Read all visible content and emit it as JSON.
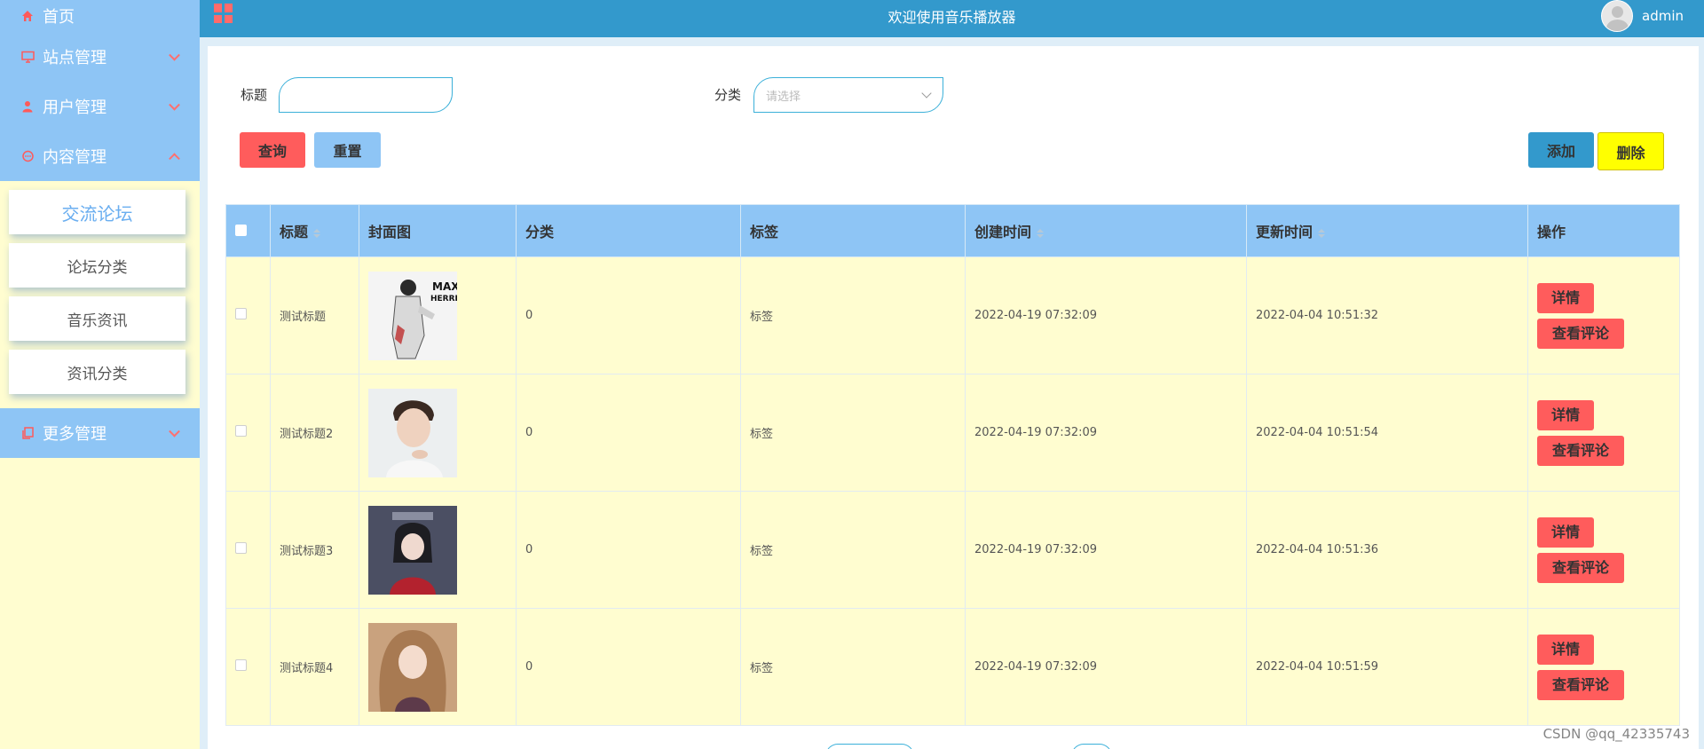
{
  "header": {
    "title": "欢迎使用音乐播放器",
    "username": "admin"
  },
  "sidebar": {
    "items": [
      {
        "label": "首页",
        "icon": "home-icon"
      },
      {
        "label": "站点管理",
        "icon": "monitor-icon"
      },
      {
        "label": "用户管理",
        "icon": "user-icon"
      },
      {
        "label": "内容管理",
        "icon": "chat-icon"
      },
      {
        "label": "更多管理",
        "icon": "copy-icon"
      }
    ],
    "submenu": [
      "交流论坛",
      "论坛分类",
      "音乐资讯",
      "资讯分类"
    ]
  },
  "search": {
    "title_label": "标题",
    "title_value": "",
    "category_label": "分类",
    "category_placeholder": "请选择"
  },
  "buttons": {
    "query": "查询",
    "reset": "重置",
    "add": "添加",
    "delete": "删除"
  },
  "table": {
    "headers": {
      "title": "标题",
      "cover": "封面图",
      "category": "分类",
      "tag": "标签",
      "created": "创建时间",
      "updated": "更新时间",
      "actions": "操作"
    },
    "rows": [
      {
        "title": "测试标题",
        "category": "0",
        "tag": "标签",
        "created": "2022-04-19 07:32:09",
        "updated": "2022-04-04 10:51:32",
        "detail": "详情",
        "comment": "查看评论"
      },
      {
        "title": "测试标题2",
        "category": "0",
        "tag": "标签",
        "created": "2022-04-19 07:32:09",
        "updated": "2022-04-04 10:51:54",
        "detail": "详情",
        "comment": "查看评论"
      },
      {
        "title": "测试标题3",
        "category": "0",
        "tag": "标签",
        "created": "2022-04-19 07:32:09",
        "updated": "2022-04-04 10:51:36",
        "detail": "详情",
        "comment": "查看评论"
      },
      {
        "title": "测试标题4",
        "category": "0",
        "tag": "标签",
        "created": "2022-04-19 07:32:09",
        "updated": "2022-04-04 10:51:59",
        "detail": "详情",
        "comment": "查看评论"
      }
    ]
  },
  "watermark": "CSDN @qq_42335743",
  "colors": {
    "header_bg": "#3399cc",
    "sidebar_menu_bg": "#8ec5f5",
    "sidebar_bg": "#fffdd0",
    "accent_red": "#ff5c5c",
    "delete_yellow": "#ffff00"
  }
}
